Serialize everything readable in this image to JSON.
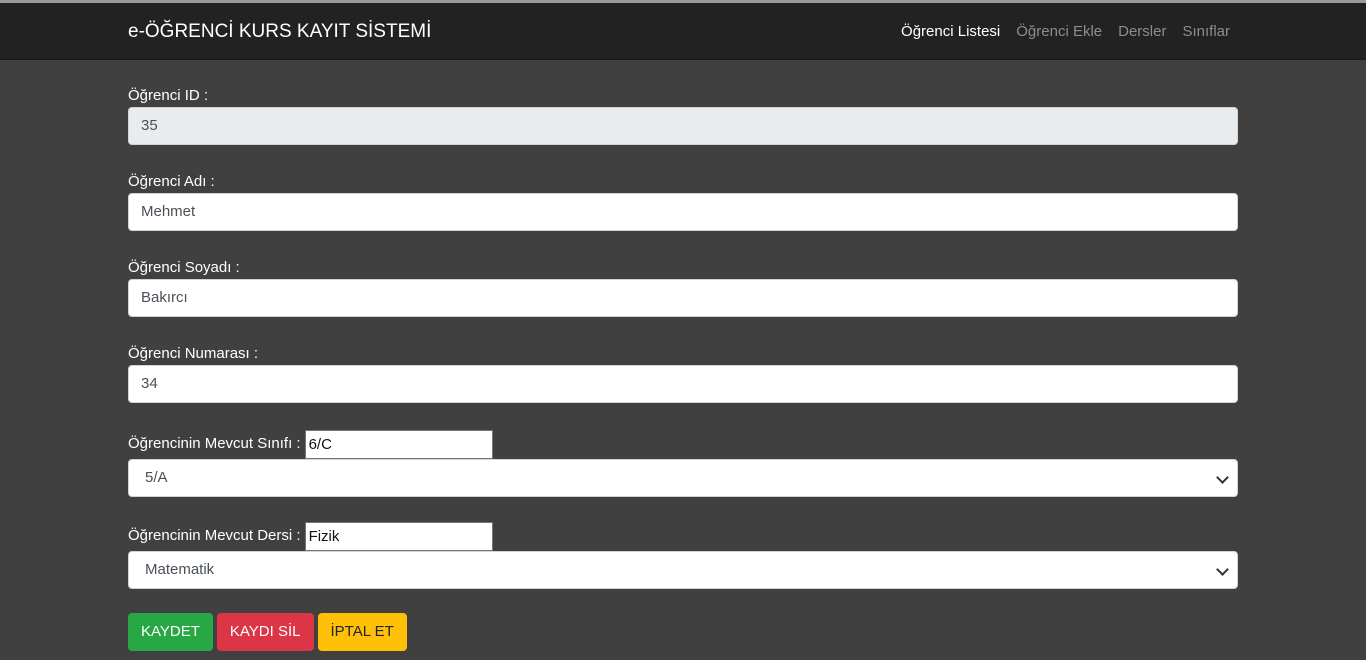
{
  "navbar": {
    "brand": "e-ÖĞRENCİ KURS KAYIT SİSTEMİ",
    "links": [
      {
        "label": "Öğrenci Listesi",
        "active": true
      },
      {
        "label": "Öğrenci Ekle",
        "active": false
      },
      {
        "label": "Dersler",
        "active": false
      },
      {
        "label": "Sınıflar",
        "active": false
      }
    ]
  },
  "form": {
    "student_id": {
      "label": "Öğrenci ID :",
      "value": "35"
    },
    "first_name": {
      "label": "Öğrenci Adı :",
      "value": "Mehmet"
    },
    "last_name": {
      "label": "Öğrenci Soyadı :",
      "value": "Bakırcı"
    },
    "number": {
      "label": "Öğrenci Numarası :",
      "value": "34"
    },
    "current_class": {
      "label": "Öğrencinin Mevcut Sınıfı :",
      "current": "6/C",
      "selected": "5/A"
    },
    "current_course": {
      "label": "Öğrencinin Mevcut Dersi :",
      "current": "Fizik",
      "selected": "Matematik"
    }
  },
  "buttons": {
    "save": "KAYDET",
    "delete": "KAYDI SİL",
    "cancel": "İPTAL ET"
  },
  "colors": {
    "save": "#28a745",
    "delete": "#dc3545",
    "cancel": "#ffc107",
    "navbar": "#222222",
    "background": "#404040"
  }
}
